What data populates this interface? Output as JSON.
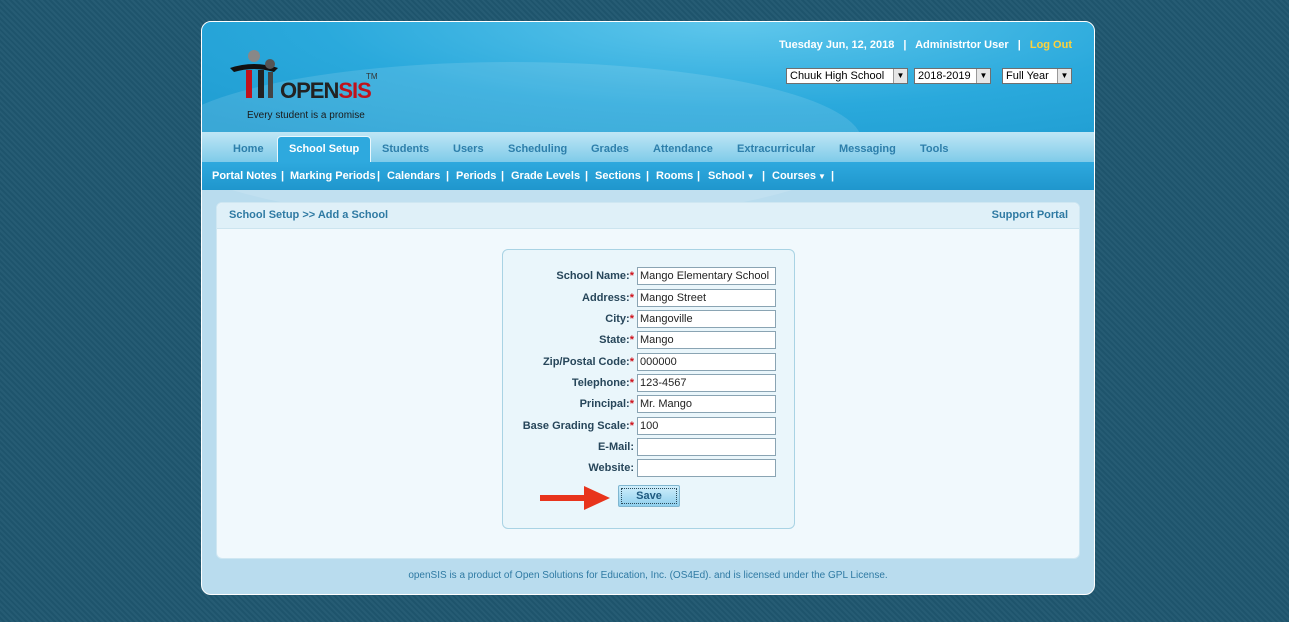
{
  "header": {
    "logo_text_prefix": "OPEN",
    "logo_text_suffix": "SIS",
    "logo_tm": "TM",
    "logo_tagline": "Every student is a promise",
    "date": "Tuesday Jun, 12, 2018",
    "separator": "|",
    "user": "Administrtor User",
    "logout": "Log Out",
    "school_select": "Chuuk High School",
    "year_select": "2018-2019",
    "term_select": "Full Year"
  },
  "nav": {
    "items": [
      "Home",
      "School Setup",
      "Students",
      "Users",
      "Scheduling",
      "Grades",
      "Attendance",
      "Extracurricular",
      "Messaging",
      "Tools"
    ]
  },
  "subnav": {
    "items": [
      "Portal Notes",
      "Marking Periods",
      "Calendars",
      "Periods",
      "Grade Levels",
      "Sections",
      "Rooms",
      "School",
      "Courses"
    ],
    "separator": "|"
  },
  "panel": {
    "breadcrumb": "School Setup >> Add a School",
    "support_link": "Support Portal"
  },
  "form": {
    "required_mark": "*",
    "fields": [
      {
        "label": "School Name:",
        "value": "Mango Elementary School"
      },
      {
        "label": "Address:",
        "value": "Mango Street"
      },
      {
        "label": "City:",
        "value": "Mangoville"
      },
      {
        "label": "State:",
        "value": "Mango"
      },
      {
        "label": "Zip/Postal Code:",
        "value": "000000"
      },
      {
        "label": "Telephone:",
        "value": "123-4567"
      },
      {
        "label": "Principal:",
        "value": "Mr. Mango"
      },
      {
        "label": "Base Grading Scale:",
        "value": "100"
      },
      {
        "label": "E-Mail:",
        "value": ""
      },
      {
        "label": "Website:",
        "value": ""
      }
    ],
    "save_label": "Save"
  },
  "footer": {
    "text": "openSIS is a product of Open Solutions for Education, Inc. (OS4Ed). and is licensed under the GPL License."
  },
  "colors": {
    "page_bg": "#1f5770",
    "header_blue": "#2aa9dc",
    "link_blue": "#2f7aa3",
    "required_red": "#d0121b",
    "logout_yellow": "#ffd23a",
    "arrow_red": "#e8341c"
  }
}
